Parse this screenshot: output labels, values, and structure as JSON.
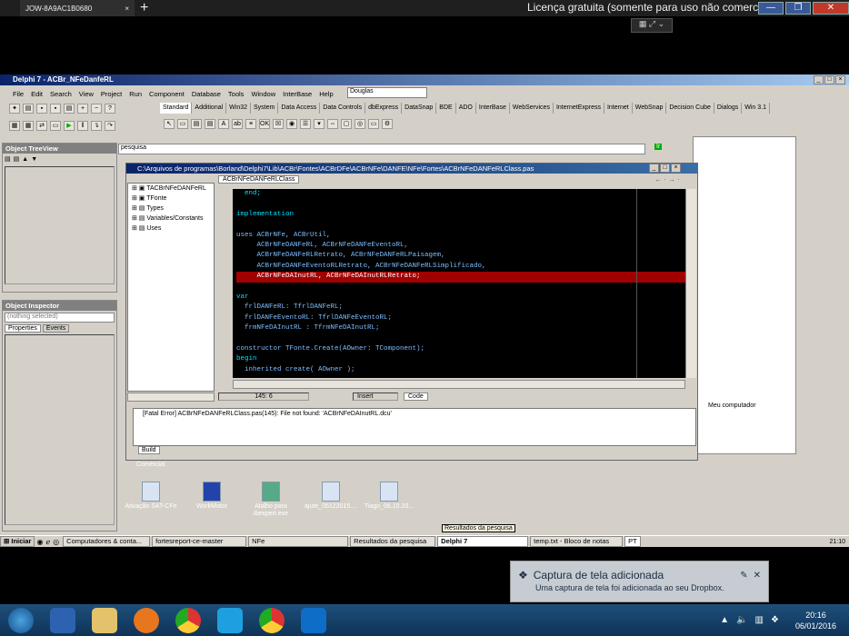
{
  "teamviewer": {
    "tab_label": "JOW-8A9AC1B0680",
    "tab_close": "×",
    "add_tab": "+",
    "license": "Licença gratuita (somente para uso não comercial)",
    "min": "—",
    "restore": "❐",
    "close": "✕"
  },
  "delphi": {
    "title": "Delphi 7 - ACBr_NFeDanfeRL",
    "menu": [
      "File",
      "Edit",
      "Search",
      "View",
      "Project",
      "Run",
      "Component",
      "Database",
      "Tools",
      "Window",
      "InterBase",
      "Help"
    ],
    "desktop_combo": "Douglas",
    "palette_tabs": [
      "Standard",
      "Additional",
      "Win32",
      "System",
      "Data Access",
      "Data Controls",
      "dbExpress",
      "DataSnap",
      "BDE",
      "ADO",
      "InterBase",
      "WebServices",
      "InternetExpress",
      "Internet",
      "WebSnap",
      "Decision Cube",
      "Dialogs",
      "Win 3.1"
    ],
    "search_label": "pesquisa",
    "go_label": "Ir",
    "object_treeview": "Object TreeView",
    "object_inspector": "Object Inspector",
    "inspector_combo": "(nothing selected)",
    "inspector_tabs": [
      "Properties",
      "Events"
    ],
    "editor_title": "C:\\Arquivos de programas\\Borland\\Delphi7\\Lib\\ACBr\\Fontes\\ACBrDFe\\ACBrNFe\\DANFE\\NFe\\Fortes\\ACBrNFeDANFeRLClass.pas",
    "editor_tab": "ACBrNFeDANFeRLClass",
    "tree_items": [
      "TACBrNFeDANFeRL",
      "TFonte",
      "Types",
      "Variables/Constants",
      "Uses"
    ],
    "code_lines": [
      {
        "t": "  end;",
        "k": 1
      },
      {
        "t": "",
        "k": 0
      },
      {
        "t": "implementation",
        "k": 1
      },
      {
        "t": "",
        "k": 0
      },
      {
        "t": "uses ACBrNFe, ACBrUtil,",
        "k": 0
      },
      {
        "t": "     ACBrNFeDANFeRL, ACBrNFeDANFeEventoRL,",
        "k": 0
      },
      {
        "t": "     ACBrNFeDANFeRLRetrato, ACBrNFeDANFeRLPaisagem,",
        "k": 0
      },
      {
        "t": "     ACBrNFeDANFeEventoRLRetrato, ACBrNFeDANFeRLSimplificado,",
        "k": 0
      },
      {
        "t": "     ACBrNFeDAInutRL, ACBrNFeDAInutRLRetrato;",
        "k": 2
      },
      {
        "t": "",
        "k": 0
      },
      {
        "t": "var",
        "k": 1
      },
      {
        "t": "  frlDANFeRL: TfrlDANFeRL;",
        "k": 0
      },
      {
        "t": "  frlDANFeEventoRL: TfrlDANFeEventoRL;",
        "k": 0
      },
      {
        "t": "  frmNFeDAInutRL : TfrmNFeDAInutRL;",
        "k": 0
      },
      {
        "t": "",
        "k": 0
      },
      {
        "t": "constructor TFonte.Create(AOwner: TComponent);",
        "k": 0
      },
      {
        "t": "begin",
        "k": 1
      },
      {
        "t": "  inherited create( AOwner );",
        "k": 0
      }
    ],
    "status_pos": "145:  6",
    "status_mode": "Insert",
    "status_tab": "Code",
    "message": "[Fatal Error] ACBrNFeDANFeRLClass.pas(145): File not found: 'ACBrNFeDAInutRL.dcu'",
    "build_tab": "Build",
    "meu_computador": "Meu computador",
    "comercial": "Comercial"
  },
  "desktop_icons": [
    {
      "label": "Ativação SAT-CFe"
    },
    {
      "label": "WorkMotor"
    },
    {
      "label": "Atalho para ibexpert.exe"
    },
    {
      "label": "ajute_05122015...."
    },
    {
      "label": "Tiago_06.10.20..."
    }
  ],
  "tooltip": "Resultados da pesquisa",
  "taskbar": {
    "start": "Iniciar",
    "tasks": [
      "Computadores & conta...",
      "fortesreport-ce-master",
      "NFe",
      "Resultados da pesquisa",
      "Delphi 7",
      "temp.txt - Bloco de notas"
    ],
    "lang": "PT",
    "time": "21:10"
  },
  "dropbox": {
    "title": "Captura de tela adicionada",
    "body": "Uma captura de tela foi adicionada ao seu Dropbox."
  },
  "win7": {
    "time": "20:16",
    "date": "06/01/2016"
  }
}
